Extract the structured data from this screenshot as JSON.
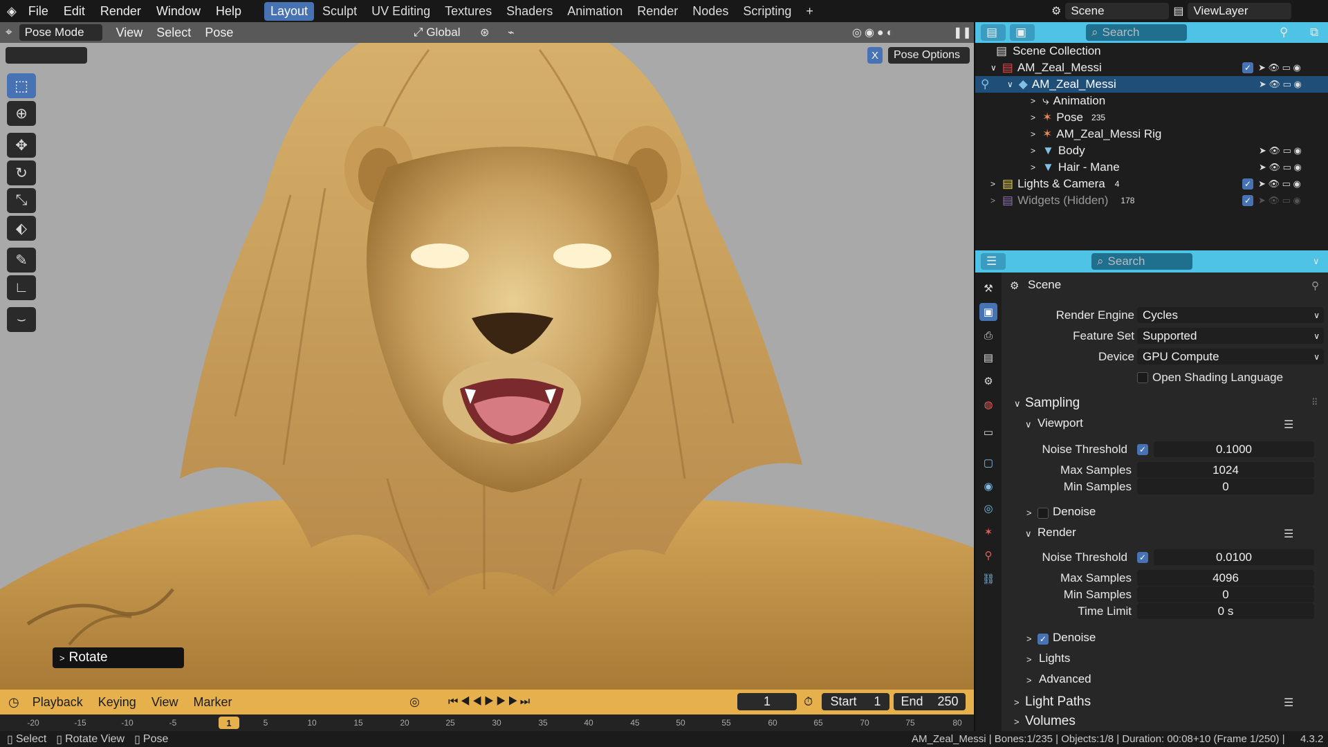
{
  "topbar": {
    "menus": [
      "File",
      "Edit",
      "Render",
      "Window",
      "Help"
    ],
    "workspaces": [
      "Layout",
      "Sculpt",
      "UV Editing",
      "Textures",
      "Shaders",
      "Animation",
      "Render",
      "Nodes",
      "Scripting"
    ],
    "active_workspace": "Layout",
    "add_tab": "+",
    "scene_label": "Scene",
    "viewlayer_label": "ViewLayer"
  },
  "viewport": {
    "mode": "Pose Mode",
    "menus": [
      "View",
      "Select",
      "Pose"
    ],
    "transform_orientation": "Global",
    "pose_options": "Pose Options",
    "x_axis": "X",
    "tools": [
      "select-box-icon",
      "cursor-icon",
      "move-icon",
      "rotate-icon",
      "scale-icon",
      "transform-icon",
      "annotate-icon",
      "measure-icon",
      "relax-icon"
    ],
    "operator_panel": "Rotate"
  },
  "timeline": {
    "menus": [
      "Playback",
      "Keying",
      "View",
      "Marker"
    ],
    "current_frame": "1",
    "start_label": "Start",
    "start_value": "1",
    "end_label": "End",
    "end_value": "250",
    "ruler_ticks": [
      "-20",
      "-15",
      "-10",
      "-5",
      "1",
      "5",
      "10",
      "15",
      "20",
      "25",
      "30",
      "35",
      "40",
      "45",
      "50",
      "55",
      "60",
      "65",
      "70",
      "75",
      "80"
    ],
    "ruler_frame": "1"
  },
  "statusbar": {
    "hints": [
      "Select",
      "Rotate View",
      "Pose"
    ],
    "info": "AM_Zeal_Messi | Bones:1/235 | Objects:1/8 | Duration: 00:08+10 (Frame 1/250) |",
    "version": "4.3.2"
  },
  "outliner": {
    "search_placeholder": "Search",
    "rows": [
      {
        "label": "Scene Collection"
      },
      {
        "label": "AM_Zeal_Messi"
      },
      {
        "label": "AM_Zeal_Messi"
      },
      {
        "label": "Animation"
      },
      {
        "label": "Pose",
        "badge": "235"
      },
      {
        "label": "AM_Zeal_Messi Rig"
      },
      {
        "label": "Body"
      },
      {
        "label": "Hair - Mane"
      },
      {
        "label": "Lights & Camera",
        "badge": "4"
      },
      {
        "label": "Widgets (Hidden)",
        "badge": "178"
      }
    ]
  },
  "properties": {
    "search_placeholder": "Search",
    "context": "Scene",
    "render_engine_label": "Render Engine",
    "render_engine": "Cycles",
    "feature_set_label": "Feature Set",
    "feature_set": "Supported",
    "device_label": "Device",
    "device": "GPU Compute",
    "osl_label": "Open Shading Language",
    "sampling": "Sampling",
    "viewport_section": "Viewport",
    "vp_noise_label": "Noise Threshold",
    "vp_noise": "0.1000",
    "vp_max_label": "Max Samples",
    "vp_max": "1024",
    "vp_min_label": "Min Samples",
    "vp_min": "0",
    "vp_denoise": "Denoise",
    "render_section": "Render",
    "r_noise_label": "Noise Threshold",
    "r_noise": "0.0100",
    "r_max_label": "Max Samples",
    "r_max": "4096",
    "r_min_label": "Min Samples",
    "r_min": "0",
    "r_time_label": "Time Limit",
    "r_time": "0 s",
    "r_denoise": "Denoise",
    "lights": "Lights",
    "advanced": "Advanced",
    "light_paths": "Light Paths",
    "volumes": "Volumes"
  },
  "colors": {
    "accent": "#4772b3",
    "header_blue": "#4ec3e6",
    "timeline_orange": "#e6b04c"
  }
}
